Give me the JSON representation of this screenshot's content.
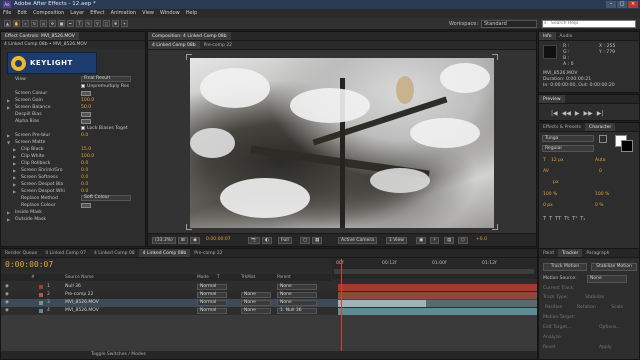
{
  "window": {
    "title": "Adobe After Effects - 12.aep *",
    "app_icon": "Ae"
  },
  "menu": [
    "File",
    "Edit",
    "Composition",
    "Layer",
    "Effect",
    "Animation",
    "View",
    "Window",
    "Help"
  ],
  "toolbar": {
    "workspace_label": "Workspace:",
    "workspace_value": "Standard",
    "search_placeholder": "Search Help"
  },
  "effect_controls": {
    "tab": "Effect Controls: MVI_8526.MOV",
    "breadcrumb": "4 Linked Comp 08b • MVI_8526.MOV",
    "plugin": "KEYLIGHT",
    "rows": [
      {
        "label": "View",
        "value": "Final Result"
      },
      {
        "label": "Unpremultiply Res",
        "value": ""
      },
      {
        "label": "Screen Colour",
        "value": ""
      },
      {
        "label": "Screen Gain",
        "value": "100.0"
      },
      {
        "label": "Screen Balance",
        "value": "50.0"
      },
      {
        "label": "Despill Bias",
        "value": ""
      },
      {
        "label": "Alpha Bias",
        "value": ""
      },
      {
        "label": "Lock Biases Toget",
        "value": ""
      },
      {
        "label": "Screen Pre-blur",
        "value": "0.0"
      },
      {
        "label": "Screen Matte",
        "value": ""
      },
      {
        "label": "Clip Black",
        "value": "15.0"
      },
      {
        "label": "Clip White",
        "value": "100.0"
      },
      {
        "label": "Clip Rollback",
        "value": "0.0"
      },
      {
        "label": "Screen Shrink/Gro",
        "value": "0.0"
      },
      {
        "label": "Screen Softness",
        "value": "0.0"
      },
      {
        "label": "Screen Despot Bla",
        "value": "0.0"
      },
      {
        "label": "Screen Despot Whi",
        "value": "0.0"
      },
      {
        "label": "Replace Method",
        "value": "Soft Colour"
      },
      {
        "label": "Replace Colour",
        "value": ""
      },
      {
        "label": "Inside Mask",
        "value": ""
      },
      {
        "label": "Outside Mask",
        "value": ""
      }
    ]
  },
  "composition": {
    "tab": "Composition: 4 Linked Comp 08b",
    "sub_tabs": [
      "4 Linked Comp 08b",
      "Pre-comp 22"
    ],
    "bottom": {
      "zoom": "(33.3%)",
      "timecode": "0:00:00:07",
      "resolution": "Full",
      "camera": "Active Camera",
      "views": "1 View",
      "exposure": "+0.0"
    }
  },
  "info": {
    "tabs": [
      "Info",
      "Audio"
    ],
    "r": "R :",
    "g": "G :",
    "b": "B :",
    "a": "A : 0",
    "x": "X : 255",
    "y": "Y : 779",
    "file": "MVI_8526.MOV",
    "duration": "Duration: 0:00:00:21",
    "in_out": "In: 0:00:00:00, Out: 0:00:00:20"
  },
  "preview": {
    "tab": "Preview",
    "buttons": [
      "|◀",
      "◀◀",
      "▶",
      "▶▶",
      "▶|"
    ]
  },
  "effects_presets": {
    "tabs": [
      "Effects & Presets",
      "Character"
    ]
  },
  "character": {
    "font": "Tunga",
    "style": "Regular",
    "size": "12 px",
    "leading": "Auto",
    "tracking": "0",
    "stroke": "px",
    "vscale": "100 %",
    "hscale": "100 %",
    "baseline": "0 px",
    "tsume": "0 %"
  },
  "timeline": {
    "tabs": [
      "Render Queue",
      "4 Linked Comp 07",
      "4 Linked Comp 08",
      "4 Linked Comp 08b",
      "Pre-comp 22"
    ],
    "timecode": "0:00:00:07",
    "ruler": [
      "00f",
      "00:12f",
      "01:00f",
      "01:12f"
    ],
    "columns": [
      "#",
      "Source Name",
      "Mode",
      "T",
      "TrkMat",
      "Parent"
    ],
    "layers": [
      {
        "num": "1",
        "name": "Null 36",
        "mode": "Normal",
        "trkmat": "",
        "parent": "None",
        "color": "#a33b2e"
      },
      {
        "num": "2",
        "name": "Pre-comp 22",
        "mode": "Normal",
        "trkmat": "None",
        "parent": "None",
        "color": "#b05a40"
      },
      {
        "num": "3",
        "name": "MVI_8526.MOV",
        "mode": "Normal",
        "trkmat": "None",
        "parent": "None",
        "color": "#7b8f95"
      },
      {
        "num": "4",
        "name": "MVI_8526.MOV",
        "mode": "Normal",
        "trkmat": "None",
        "parent": "1. Null 36",
        "color": "#5e8c94"
      }
    ],
    "toggle": "Toggle Switches / Modes"
  },
  "tracker": {
    "tabs": [
      "Paint",
      "Tracker",
      "Paragraph"
    ],
    "track_motion": "Track Motion",
    "stabilize": "Stabilize Motion",
    "motion_source_label": "Motion Source:",
    "motion_source": "None",
    "current_track_label": "Current Track:",
    "track_type_label": "Track Type:",
    "track_type": "Stabilize",
    "position": "Position",
    "rotation": "Rotation",
    "scale": "Scale",
    "motion_target": "Motion Target:",
    "edit_target": "Edit Target...",
    "options": "Options...",
    "analyze": "Analyze:",
    "reset": "Reset",
    "apply": "Apply"
  }
}
